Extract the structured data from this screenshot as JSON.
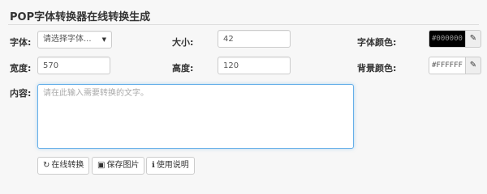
{
  "page": {
    "title": "POP字体转换器在线转换生成"
  },
  "form": {
    "font_label": "字体:",
    "font_select_value": "请选择字体...",
    "font_select_caret": "▼",
    "size_label": "大小:",
    "size_value": "42",
    "font_color_label": "字体颜色:",
    "font_color_value": "#000000",
    "width_label": "宽度:",
    "width_value": "570",
    "height_label": "高度:",
    "height_value": "120",
    "bg_color_label": "背景颜色:",
    "bg_color_value": "#FFFFFF",
    "content_label": "内容:",
    "content_placeholder": "请在此输入需要转换的文字。",
    "edit_icon_glyph": "✎"
  },
  "buttons": {
    "convert_label": "在线转换",
    "convert_icon": "↻",
    "save_label": "保存图片",
    "save_icon": "▣",
    "help_label": "使用说明",
    "help_icon": "ℹ"
  }
}
